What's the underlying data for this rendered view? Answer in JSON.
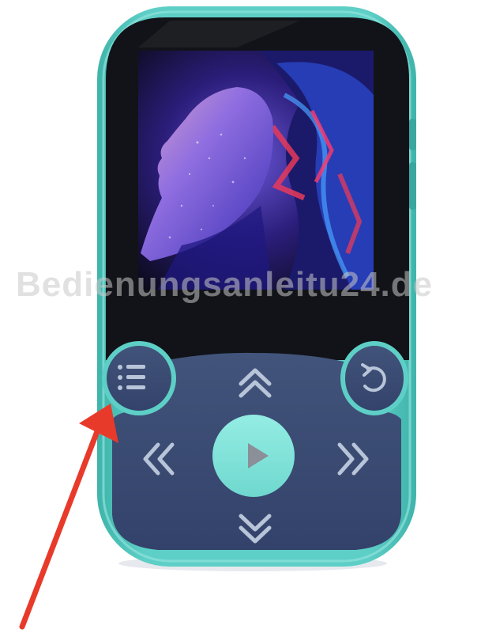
{
  "image": {
    "subject": "MP3 player",
    "watermark_text": "Bedienungsanleitu24.de"
  },
  "colors": {
    "shell": "#5ecfc6",
    "shell_dark": "#3fb4ab",
    "panel": "#3d4d74",
    "panel_dark": "#33426a",
    "screen_bezel": "#111318",
    "icon": "#b8c4d8",
    "play_button": "#7fe3da",
    "play_triangle": "#8a8f98",
    "arrow": "#e83a2a"
  },
  "device": {
    "screen": {
      "content": "album-art"
    },
    "buttons": [
      {
        "name": "menu",
        "icon": "menu-icon"
      },
      {
        "name": "back",
        "icon": "back-icon"
      },
      {
        "name": "up",
        "icon": "chevron-up-double-icon"
      },
      {
        "name": "previous",
        "icon": "chevron-left-double-icon"
      },
      {
        "name": "play",
        "icon": "play-icon"
      },
      {
        "name": "next",
        "icon": "chevron-right-double-icon"
      },
      {
        "name": "down",
        "icon": "chevron-down-double-icon"
      }
    ]
  },
  "annotation": {
    "type": "arrow",
    "points_to": "menu"
  }
}
